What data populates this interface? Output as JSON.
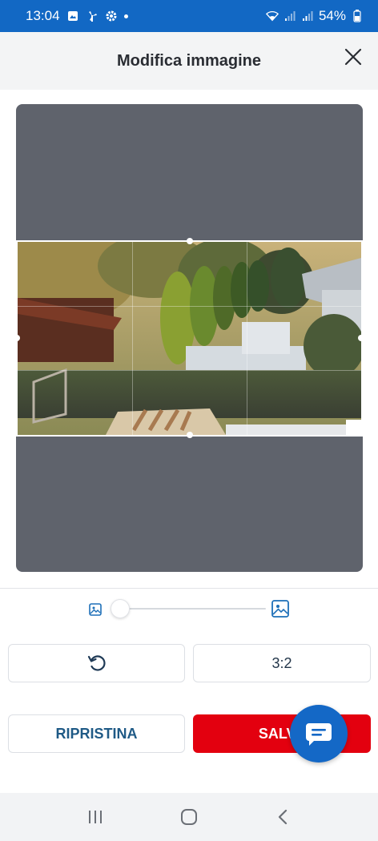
{
  "status_bar": {
    "time": "13:04",
    "battery": "54%",
    "icons_left": [
      "gallery-icon",
      "fan-icon",
      "settings-icon",
      "dot-icon"
    ],
    "icons_right": [
      "wifi-icon",
      "signal-icon",
      "signal-icon",
      "battery-icon"
    ]
  },
  "header": {
    "title": "Modifica immagine",
    "close_icon": "close-icon"
  },
  "editor": {
    "zoom_level": 0.0
  },
  "controls": {
    "rotate_icon": "rotate-ccw-icon",
    "aspect_ratio_label": "3:2"
  },
  "actions": {
    "reset_label": "RIPRISTINA",
    "save_label": "SALVA"
  },
  "fab": {
    "icon": "chat-icon"
  },
  "nav_bar": {
    "items": [
      "recents-icon",
      "home-icon",
      "back-icon"
    ]
  },
  "colors": {
    "status_bar": "#1268c4",
    "save_button": "#e3000f",
    "fab": "#1468c6",
    "crop_backdrop": "#5f636c"
  }
}
